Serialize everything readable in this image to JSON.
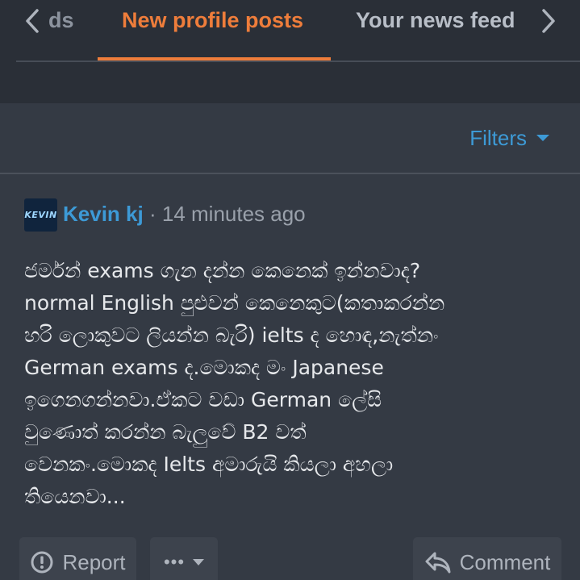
{
  "tabs": {
    "prev_label": "ds",
    "active_label": "New profile posts",
    "next_label": "Your news feed"
  },
  "filters": {
    "label": "Filters"
  },
  "post": {
    "avatar_text": "KEVIN",
    "author": "Kevin kj",
    "separator": "·",
    "time": "14 minutes ago",
    "lines": [
      "ජර්මන් exams ගැන දන්න කෙනෙක් ඉන්නවාද?",
      "normal English පුළුවන් කෙනෙකුට(කතාකරන්න",
      "හරි ලොකුවට ලියන්න බැරි) ielts ද හොඳ,නැත්නං",
      "German exams ද.මොකද මං Japanese",
      "ඉගෙනගන්නවා.ඒකට වඩා German ලේසි",
      "වුණොත් කරන්න බැලුවේ B2 වත්",
      "වෙනකං.මොකද Ielts අමාරුයි කියලා අහලා",
      "තියෙනවා..."
    ],
    "actions": {
      "report_label": "Report",
      "more_label": "•••",
      "comment_label": "Comment"
    }
  },
  "colors": {
    "accent": "#ee7d3b",
    "link": "#3d9ad6",
    "background": "#2a2f37",
    "panel": "#343a44"
  }
}
